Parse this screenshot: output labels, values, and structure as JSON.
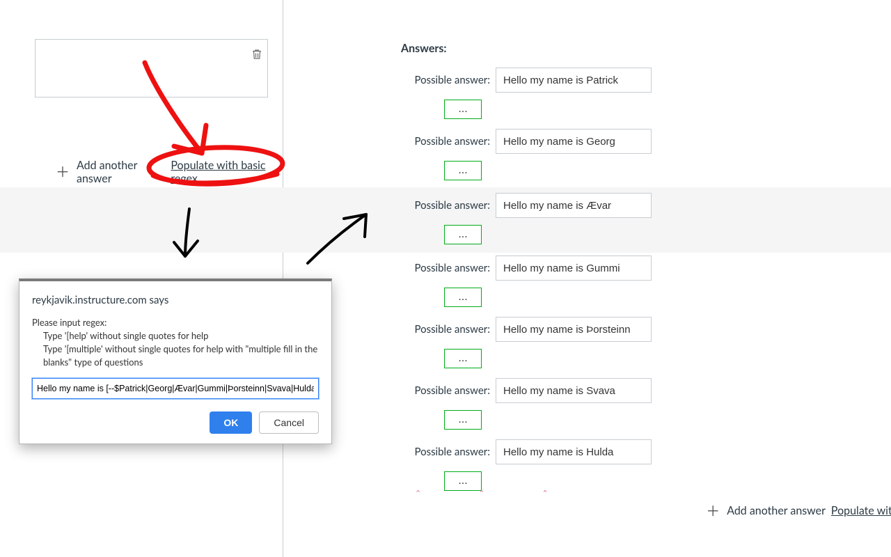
{
  "left": {
    "add_label": "Add another answer",
    "populate_label": "Populate with basic regex"
  },
  "dialog": {
    "host": "reykjavik.instructure.com says",
    "line1": "Please input regex:",
    "line2": "Type '[help' without single quotes for help",
    "line3": "Type '[multiple' without single quotes for help with \"multiple fill in the blanks\" type of questions",
    "value": "Hello my name is [--$Patrick|Georg|Ævar|Gummi|Þorsteinn|Svava|Hulda]",
    "ok": "OK",
    "cancel": "Cancel"
  },
  "answers": {
    "title": "Answers:",
    "row_label": "Possible answer:",
    "ellipsis": "...",
    "items": [
      {
        "value": "Hello my name is Patrick"
      },
      {
        "value": "Hello my name is Georg"
      },
      {
        "value": "Hello my name is Ævar"
      },
      {
        "value": "Hello my name is Gummi"
      },
      {
        "value": "Hello my name is Þorsteinn"
      },
      {
        "value": "Hello my name is Svava"
      },
      {
        "value": "Hello my name is Hulda"
      }
    ],
    "add_label": "Add another answer",
    "populate_label": "Populate with basic r"
  }
}
